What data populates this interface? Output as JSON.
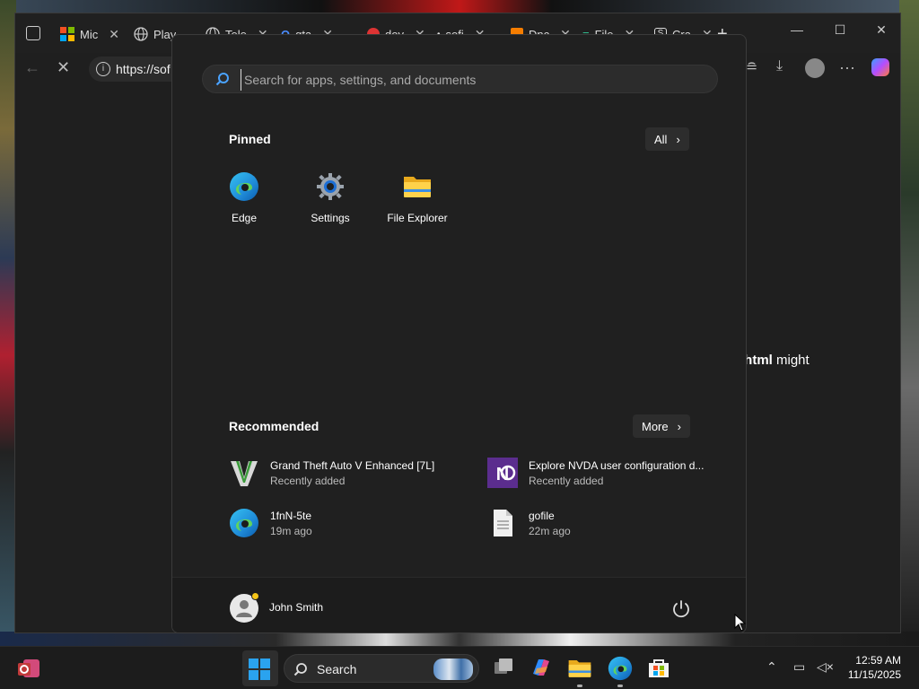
{
  "browser": {
    "tabs": [
      {
        "label": "Mic"
      },
      {
        "label": "Play"
      },
      {
        "label": "Tele"
      },
      {
        "label": "gta"
      },
      {
        "label": "dov"
      },
      {
        "label": "sofi"
      },
      {
        "label": "Dnc"
      },
      {
        "label": "File"
      },
      {
        "label": "Cra"
      }
    ],
    "address": "https://sof",
    "page_fragment_bold": "r.html",
    "page_fragment_rest": " might"
  },
  "start_menu": {
    "search_placeholder": "Search for apps, settings, and documents",
    "pinned_title": "Pinned",
    "all_label": "All",
    "pinned": [
      {
        "label": "Edge",
        "icon": "edge-icon"
      },
      {
        "label": "Settings",
        "icon": "settings-gear-icon"
      },
      {
        "label": "File Explorer",
        "icon": "folder-icon"
      }
    ],
    "recommended_title": "Recommended",
    "more_label": "More",
    "recommended": [
      {
        "title": "Grand Theft Auto V Enhanced [7L]",
        "subtitle": "Recently added",
        "icon": "gta-v-icon"
      },
      {
        "title": "Explore NVDA user configuration d...",
        "subtitle": "Recently added",
        "icon": "nvda-icon"
      },
      {
        "title": "1fnN-5te",
        "subtitle": "19m ago",
        "icon": "edge-icon"
      },
      {
        "title": "gofile",
        "subtitle": "22m ago",
        "icon": "document-icon"
      }
    ],
    "user_name": "John Smith"
  },
  "taskbar": {
    "search_label": "Search",
    "time": "12:59 AM",
    "date": "11/15/2025"
  }
}
